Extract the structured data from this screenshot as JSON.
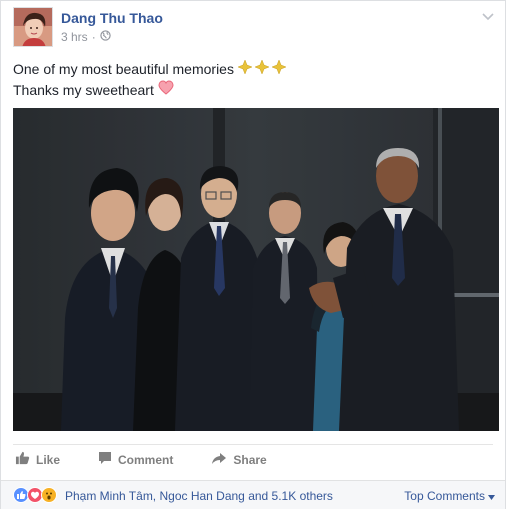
{
  "post": {
    "author": "Dang Thu Thao",
    "time": "3 hrs",
    "privacy_sep": "·",
    "privacy_icon": "globe-icon",
    "lines": [
      "One of my most beautiful memories",
      "Thanks my sweetheart"
    ],
    "emoji_line1": "sparkles",
    "emoji_line2": "heart"
  },
  "actions": {
    "like": "Like",
    "comment": "Comment",
    "share": "Share"
  },
  "footer": {
    "likers": "Phạm Minh Tâm, Ngoc Han Dang and 5.1K others",
    "top_comments": "Top Comments",
    "reactions": [
      "like",
      "love",
      "wow"
    ]
  },
  "colors": {
    "link": "#365899",
    "like": "#5890ff",
    "love": "#f25268",
    "wow": "#f7b125",
    "sparkle": "#e8c23a"
  }
}
